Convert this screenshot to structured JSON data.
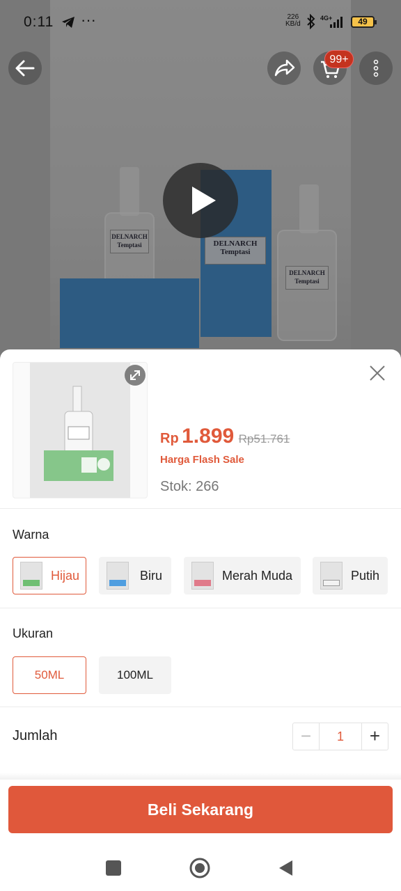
{
  "status_bar": {
    "time": "0:11",
    "net_speed_value": "226",
    "net_speed_unit": "KB/d",
    "network": "4G+",
    "battery": "49"
  },
  "top_bar": {
    "cart_badge": "99+"
  },
  "hero": {
    "label_brand": "DELNARCH",
    "label_name": "Temptasi"
  },
  "product": {
    "currency": "Rp",
    "price": "1.899",
    "original_price": "Rp51.761",
    "flash_label": "Harga Flash Sale",
    "stock": "Stok: 266"
  },
  "variants": {
    "color_title": "Warna",
    "colors": [
      {
        "label": "Hijau",
        "swatch": "#6fbf73",
        "selected": true
      },
      {
        "label": "Biru",
        "swatch": "#4f9ee0",
        "selected": false
      },
      {
        "label": "Merah Muda",
        "swatch": "#e07a8a",
        "selected": false
      },
      {
        "label": "Putih",
        "swatch": "#f2f2f2",
        "selected": false
      }
    ],
    "size_title": "Ukuran",
    "sizes": [
      {
        "label": "50ML",
        "selected": true
      },
      {
        "label": "100ML",
        "selected": false
      }
    ]
  },
  "quantity": {
    "title": "Jumlah",
    "minus": "−",
    "value": "1",
    "plus": "+"
  },
  "actions": {
    "buy_now": "Beli Sekarang"
  },
  "colors_theme": {
    "accent": "#e05a3b",
    "badge": "#c4331f"
  }
}
